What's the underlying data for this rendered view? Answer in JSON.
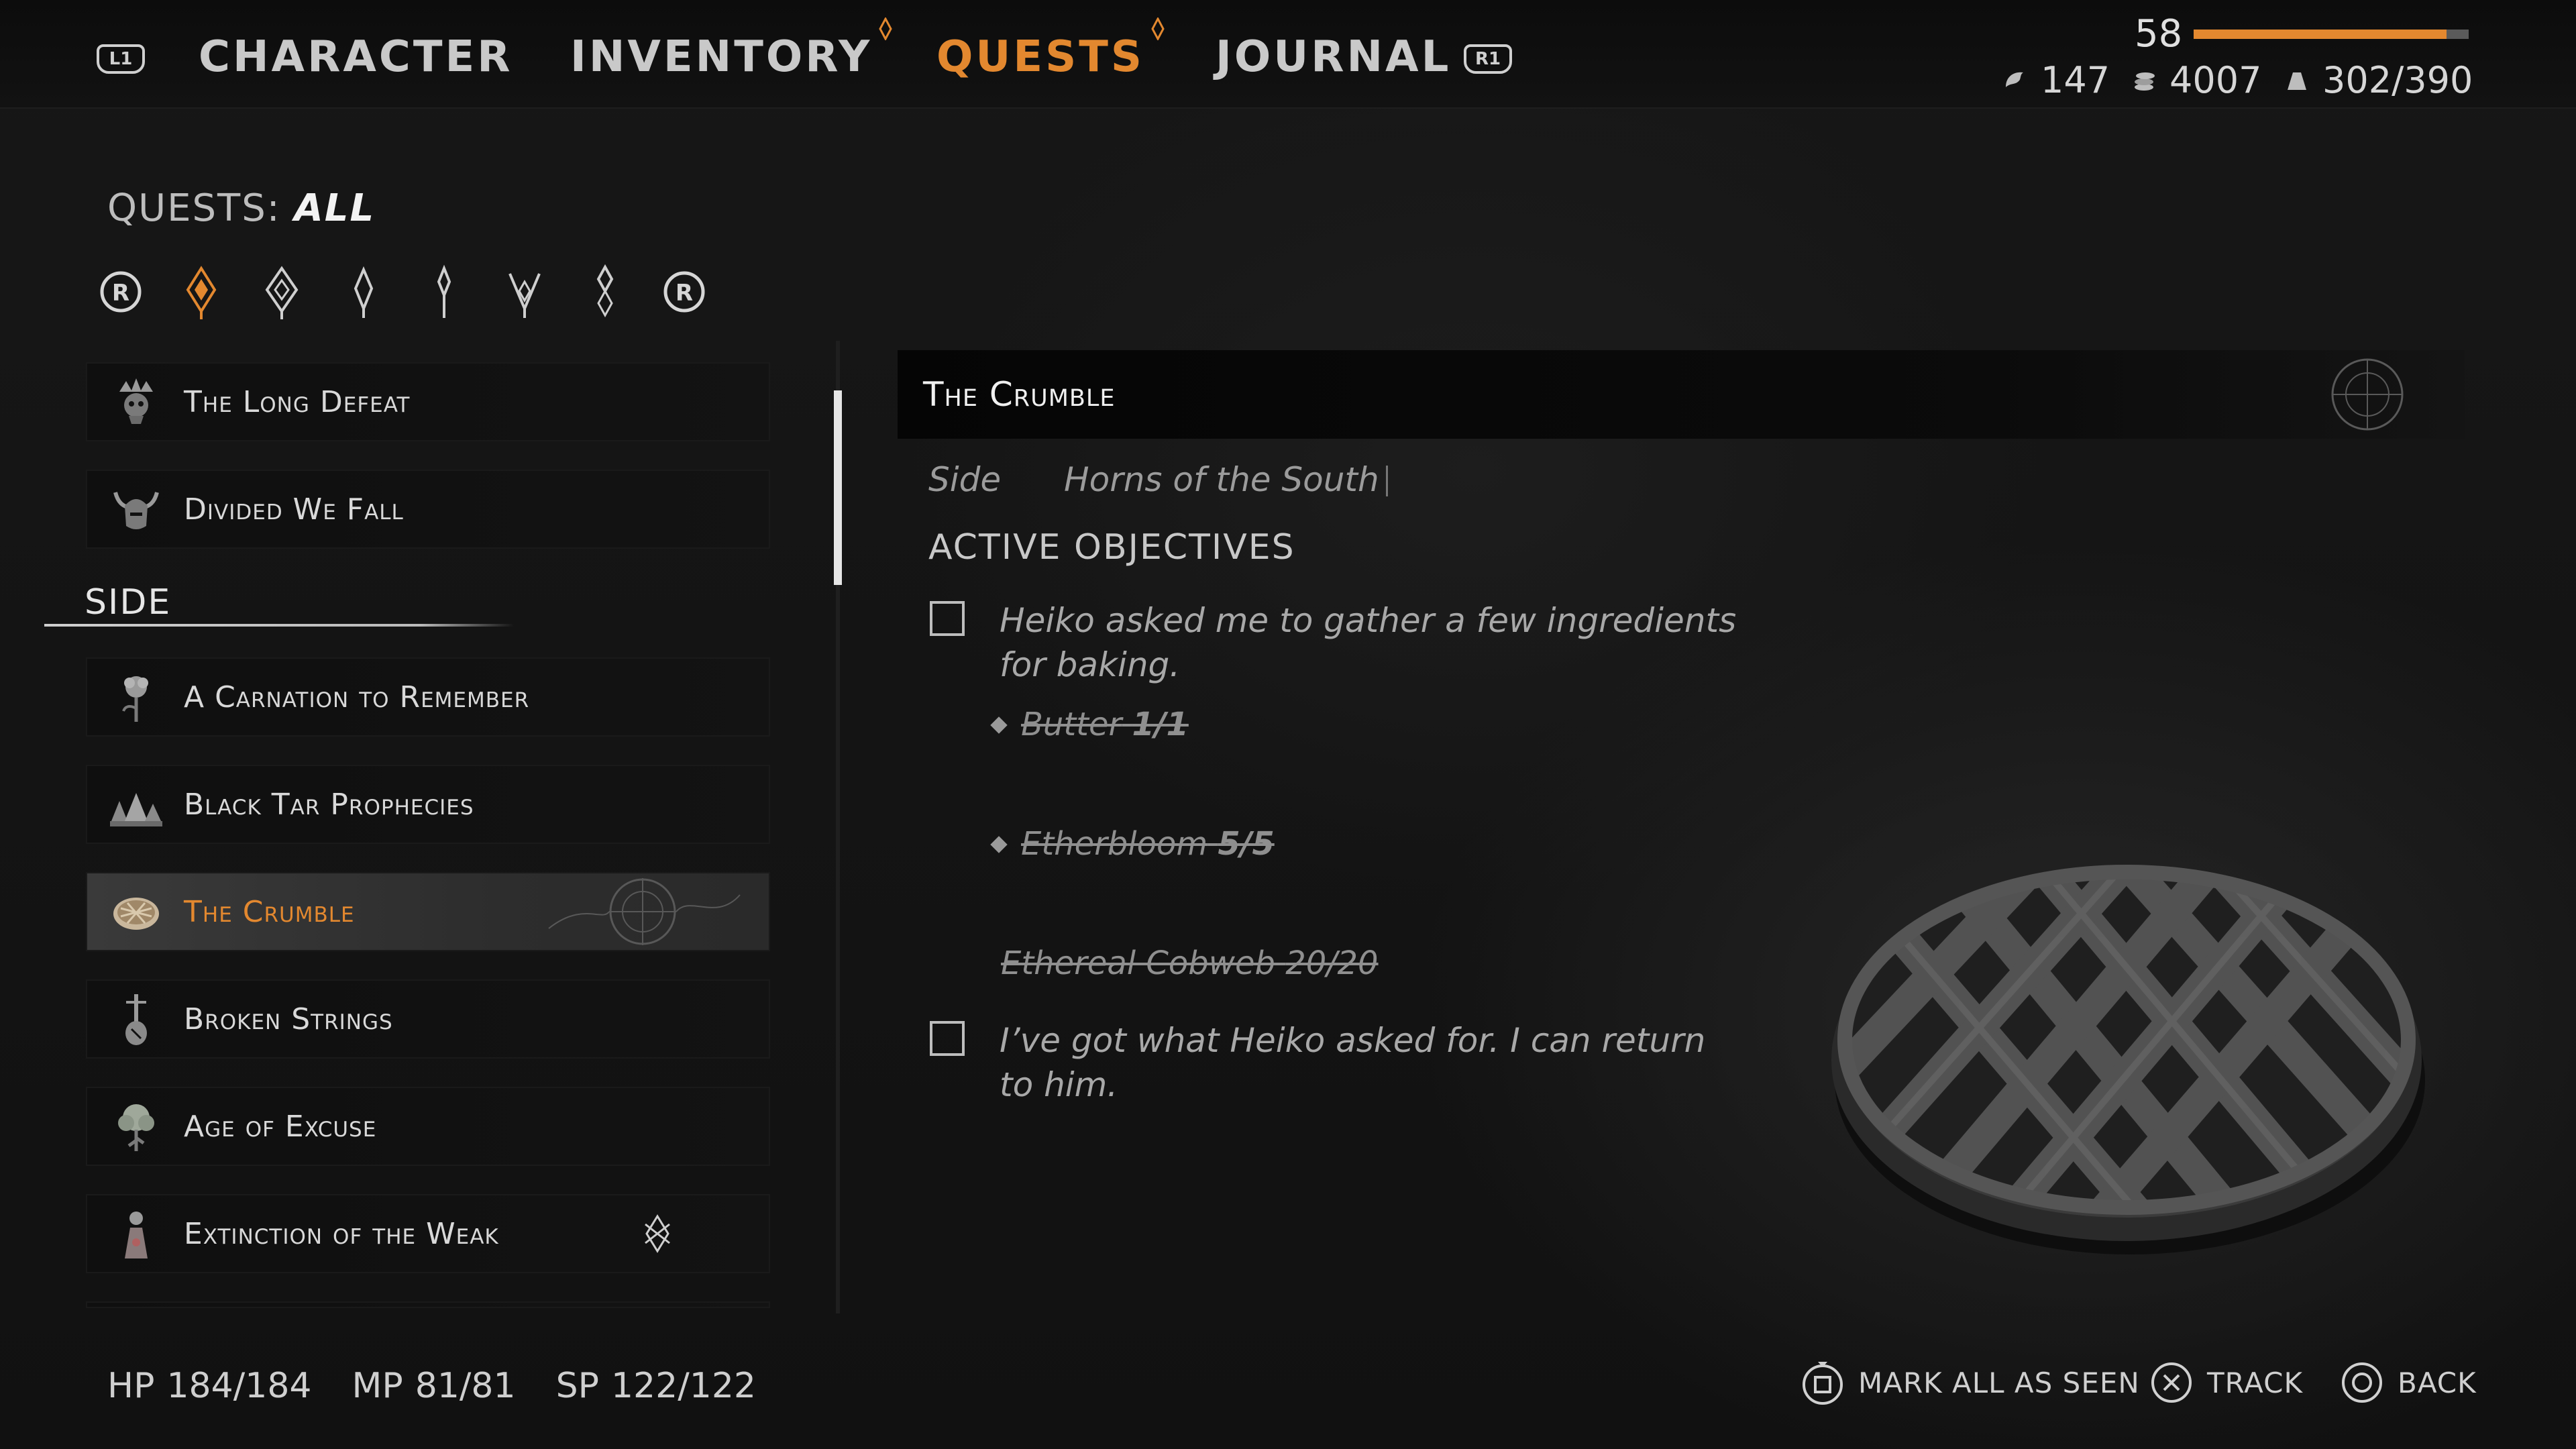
{
  "topbar": {
    "left_shoulder": "L1",
    "right_shoulder": "R1",
    "tabs": [
      {
        "label": "CHARACTER"
      },
      {
        "label": "INVENTORY"
      },
      {
        "label": "QUESTS"
      },
      {
        "label": "JOURNAL"
      }
    ],
    "active_tab": "QUESTS",
    "level": "58",
    "xp_progress": 0.92,
    "resources": {
      "skill_points": "147",
      "gold": "4007",
      "weight": "302/390"
    }
  },
  "filter": {
    "prefix": "QUESTS: ",
    "value": "ALL",
    "prev_button": "R",
    "next_button": "R"
  },
  "quests_main": [
    {
      "label": "The Long Defeat"
    },
    {
      "label": "Divided We Fall"
    }
  ],
  "side_section": "SIDE",
  "quests_side": [
    {
      "label": "A Carnation to Remember"
    },
    {
      "label": "Black Tar Prophecies"
    },
    {
      "label": "The Crumble"
    },
    {
      "label": "Broken Strings"
    },
    {
      "label": "Age of Excuse"
    },
    {
      "label": "Extinction of the Weak"
    }
  ],
  "selected_quest": "The Crumble",
  "detail": {
    "title": "The Crumble",
    "type": "Side",
    "region": "Horns of the South",
    "active_objectives_label": "ACTIVE OBJECTIVES",
    "objectives": [
      {
        "text": "Heiko asked me to gather a few ingredients for baking.",
        "sub": [
          {
            "name": "Butter",
            "count": "1/1"
          },
          {
            "name": "Etherbloom",
            "count": "5/5"
          },
          {
            "name": "Ethereal Cobweb",
            "count": "20/20"
          }
        ]
      },
      {
        "text": "I’ve got what Heiko asked for. I can return to him."
      }
    ]
  },
  "vitals": {
    "hp_label": "HP",
    "hp": "184/184",
    "mp_label": "MP",
    "mp": "81/81",
    "sp_label": "SP",
    "sp": "122/122"
  },
  "prompts": {
    "mark_all": "MARK ALL AS SEEN",
    "track": "TRACK",
    "back": "BACK"
  },
  "colors": {
    "accent": "#e3882f",
    "text": "#d9d9d9"
  }
}
